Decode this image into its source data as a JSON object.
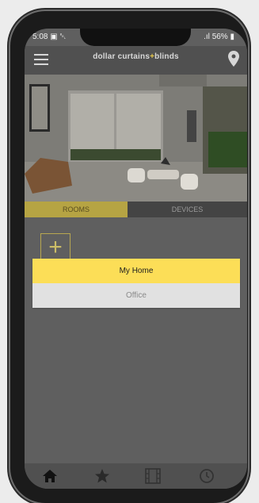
{
  "status": {
    "time": "5:08",
    "left_icons": "▣ ␇",
    "signal": ".ıl",
    "battery": "56%"
  },
  "app": {
    "brand_left": "dollar curtains",
    "brand_plus": "+",
    "brand_right": "blinds"
  },
  "tabs": [
    {
      "label": "ROOMS",
      "active": true
    },
    {
      "label": "DEVICES",
      "active": false
    }
  ],
  "add_tile": {
    "symbol": "+"
  },
  "home_selector": {
    "options": [
      {
        "label": "My Home",
        "selected": true
      },
      {
        "label": "Office",
        "selected": false
      }
    ]
  },
  "colors": {
    "accent": "#fcde57",
    "tab_active": "#b6a443",
    "overlay": "#5f5f5f"
  },
  "bottom_nav": [
    "home-icon",
    "star-icon",
    "film-icon",
    "clock-icon"
  ]
}
